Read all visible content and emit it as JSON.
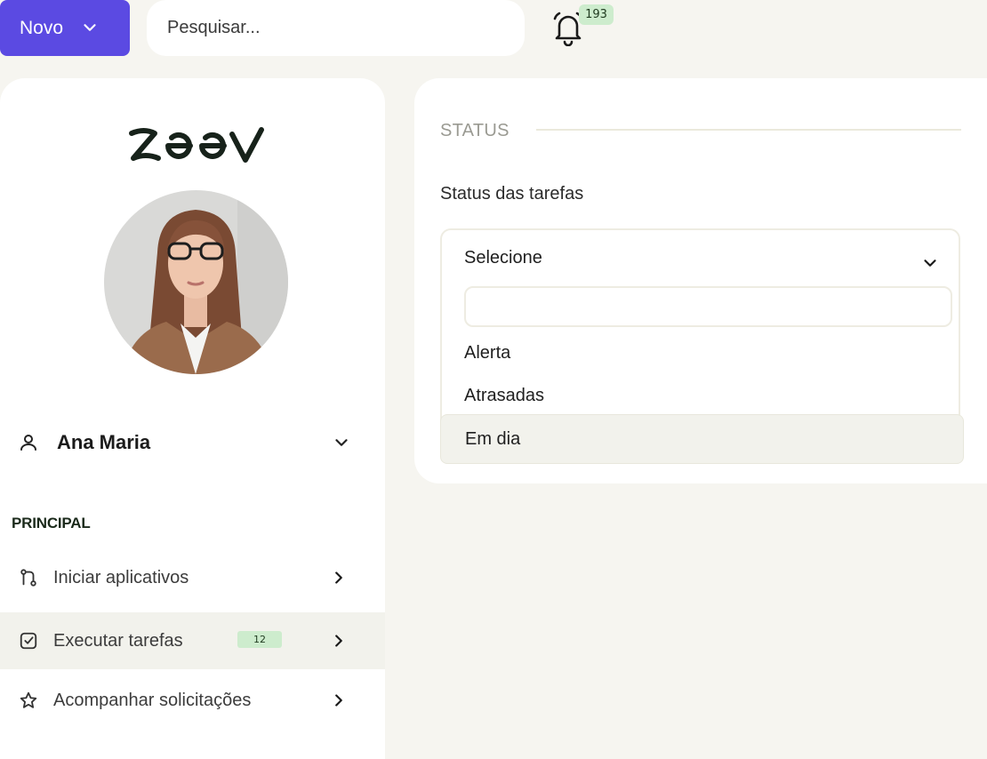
{
  "topbar": {
    "new_label": "Novo",
    "search_placeholder": "Pesquisar...",
    "notification_count": "193",
    "accent": "#5b4ae2"
  },
  "sidebar": {
    "logo_text": "zeev",
    "user_name": "Ana Maria",
    "section_label": "PRINCIPAL",
    "items": [
      {
        "label": "Iniciar aplicativos",
        "icon": "git-branch-icon"
      },
      {
        "label": "Executar tarefas",
        "icon": "check-square-icon",
        "badge": "12"
      },
      {
        "label": "Acompanhar solicitações",
        "icon": "star-icon"
      }
    ]
  },
  "panel": {
    "section_title": "STATUS",
    "field_label": "Status das tarefas",
    "select": {
      "value": "Selecione",
      "search_value": "",
      "options": [
        "Alerta",
        "Atrasadas",
        "Em dia"
      ]
    }
  }
}
